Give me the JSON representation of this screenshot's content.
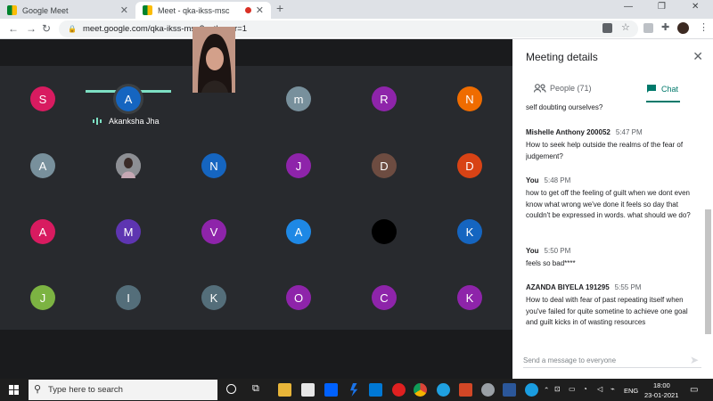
{
  "browser": {
    "tabs": [
      {
        "title": "Google Meet"
      },
      {
        "title": "Meet - qka-ikss-msc"
      }
    ],
    "url": "meet.google.com/qka-ikss-msc?authuser=1",
    "profile_letter": "a"
  },
  "meet": {
    "tiles": [
      {
        "letter": "S",
        "color": "#d81b60"
      },
      {
        "letter": "A",
        "color": "#1565c0",
        "name": "Akanksha Jha",
        "speaking": true
      },
      {
        "video": true
      },
      {
        "letter": "m",
        "color": "#78909c"
      },
      {
        "letter": "R",
        "color": "#8e24aa"
      },
      {
        "letter": "N",
        "color": "#ef6c00"
      },
      {
        "letter": "A",
        "color": "#78909c"
      },
      {
        "image": true
      },
      {
        "letter": "N",
        "color": "#1565c0"
      },
      {
        "letter": "J",
        "color": "#8e24aa"
      },
      {
        "letter": "D",
        "color": "#6d4c41"
      },
      {
        "letter": "D",
        "color": "#d84315"
      },
      {
        "letter": "A",
        "color": "#d81b60"
      },
      {
        "letter": "M",
        "color": "#5e35b1"
      },
      {
        "letter": "V",
        "color": "#8e24aa"
      },
      {
        "letter": "A",
        "color": "#1e88e5"
      },
      {
        "letter": "",
        "color": "#000000"
      },
      {
        "letter": "K",
        "color": "#1565c0"
      },
      {
        "letter": "J",
        "color": "#7cb342"
      },
      {
        "letter": "I",
        "color": "#546e7a"
      },
      {
        "letter": "K",
        "color": "#546e7a"
      },
      {
        "letter": "O",
        "color": "#8e24aa"
      },
      {
        "letter": "C",
        "color": "#8e24aa"
      },
      {
        "letter": "K",
        "color": "#8e24aa"
      }
    ]
  },
  "panel": {
    "title": "Meeting details",
    "people_tab": "People (71)",
    "chat_tab": "Chat",
    "partial_text": "self doubting ourselves?",
    "messages": [
      {
        "sender": "Mishelle Anthony 200052",
        "time": "5:47 PM",
        "text": "How to seek help outside the realms of the fear of judgement?"
      },
      {
        "sender": "You",
        "time": "5:48 PM",
        "text": "how to get off the feeling of guilt when we dont even know what wrong we've done it feels so day that couldn't be expressed in words. what should we do?"
      },
      {
        "sender": "You",
        "time": "5:50 PM",
        "text": "feels so bad****"
      },
      {
        "sender": "AZANDA BIYELA 191295",
        "time": "5:55 PM",
        "text": "How to deal with fear of past repeating itself when you've failed for quite sometine to achieve one goal and guilt kicks in of wasting  resources"
      }
    ],
    "send_placeholder": "Send a message to everyone"
  },
  "taskbar": {
    "search_placeholder": "Type here to search",
    "language": "ENG",
    "time": "18:00",
    "date": "23-01-2021"
  }
}
